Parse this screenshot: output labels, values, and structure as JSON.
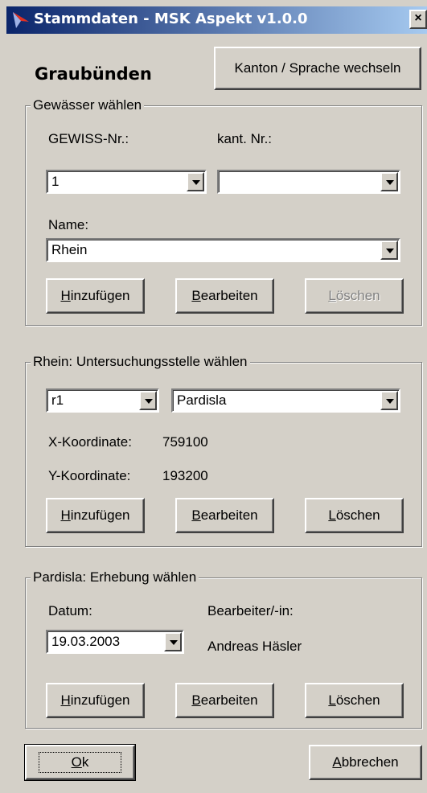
{
  "window": {
    "title": "Stammdaten - MSK Aspekt v1.0.0",
    "close": "×"
  },
  "header": {
    "canton": "Graubünden",
    "switch_button": "Kanton / Sprache wechseln"
  },
  "gewaesser": {
    "legend": "Gewässer wählen",
    "gewiss_label": "GEWISS-Nr.:",
    "gewiss_value": "1",
    "kant_label": "kant. Nr.:",
    "kant_value": "",
    "name_label": "Name:",
    "name_value": "Rhein",
    "add": {
      "accel": "H",
      "rest": "inzufügen"
    },
    "edit": {
      "accel": "B",
      "rest": "earbeiten"
    },
    "delete": {
      "accel": "L",
      "rest": "öschen"
    }
  },
  "stelle": {
    "legend": "Rhein: Untersuchungsstelle wählen",
    "code_value": "r1",
    "name_value": "Pardisla",
    "x_label": "X-Koordinate:",
    "x_value": "759100",
    "y_label": "Y-Koordinate:",
    "y_value": "193200",
    "add": {
      "accel": "H",
      "rest": "inzufügen"
    },
    "edit": {
      "accel": "B",
      "rest": "earbeiten"
    },
    "delete": {
      "accel": "L",
      "rest": "öschen"
    }
  },
  "erhebung": {
    "legend": "Pardisla: Erhebung wählen",
    "datum_label": "Datum:",
    "datum_value": "19.03.2003",
    "bearbeiter_label": "Bearbeiter/-in:",
    "bearbeiter_value": "Andreas Häsler",
    "add": {
      "accel": "H",
      "rest": "inzufügen"
    },
    "edit": {
      "accel": "B",
      "rest": "earbeiten"
    },
    "delete": {
      "accel": "L",
      "rest": "öschen"
    }
  },
  "footer": {
    "ok": {
      "accel": "O",
      "rest": "k"
    },
    "cancel": {
      "accel": "A",
      "rest": "bbrechen"
    }
  },
  "colors": {
    "titlebar_start": "#0a246a",
    "titlebar_end": "#a6caf0",
    "face": "#d4d0c8"
  }
}
